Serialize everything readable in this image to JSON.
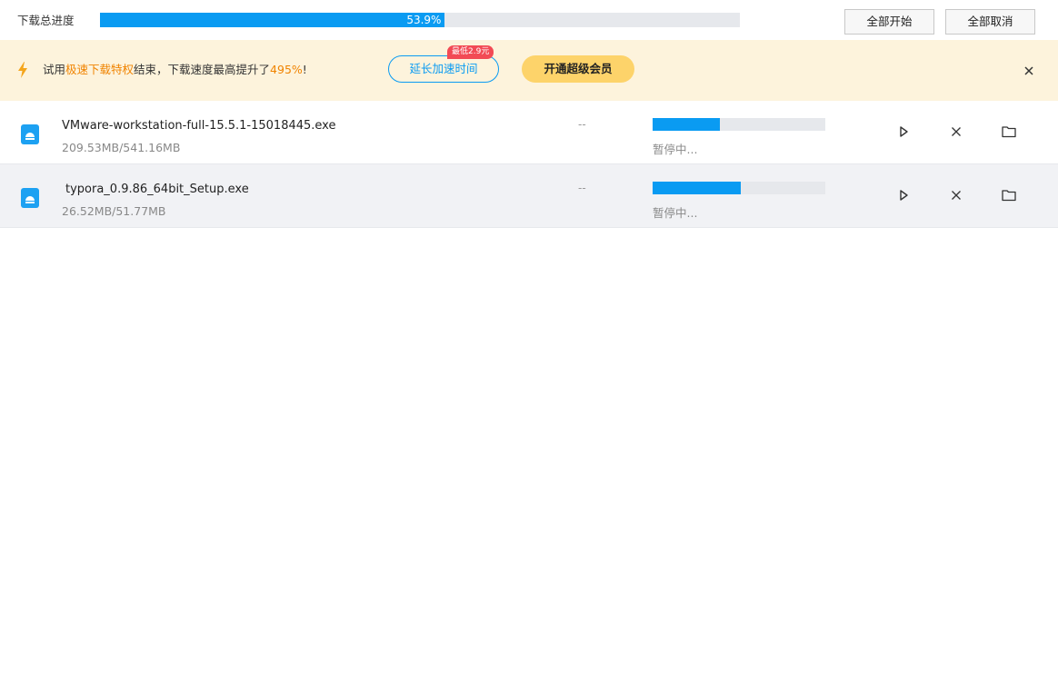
{
  "topbar": {
    "total_label": "下载总进度",
    "total_percent_text": "53.9%",
    "total_progress": 0.539,
    "start_all_label": "全部开始",
    "cancel_all_label": "全部取消"
  },
  "promo": {
    "text_pre": "试用",
    "text_hl1": "极速下载特权",
    "text_mid": "结束，下载速度最高提升了",
    "text_hl2": "495%",
    "text_post": "!",
    "extend_label": "延长加速时间",
    "price_badge": "最低2.9元",
    "vip_label": "开通超级会员",
    "icons": {
      "bolt": "lightning-icon",
      "close": "close-icon"
    },
    "colors": {
      "background": "#fdf3dc",
      "highlight": "#f08300",
      "accent": "#0a9bf2",
      "vip": "#fdd36a",
      "badge": "#f24a55"
    }
  },
  "downloads": [
    {
      "name": "VMware-workstation-full-15.5.1-15018445.exe",
      "size": "209.53MB/541.16MB",
      "speed": "--",
      "progress": 0.387,
      "status": "暂停中..."
    },
    {
      "name": "typora_0.9.86_64bit_Setup.exe",
      "size": "26.52MB/51.77MB",
      "speed": "--",
      "progress": 0.512,
      "status": "暂停中..."
    }
  ],
  "row_actions": {
    "icons": [
      "play-icon",
      "close-icon",
      "folder-icon"
    ]
  }
}
